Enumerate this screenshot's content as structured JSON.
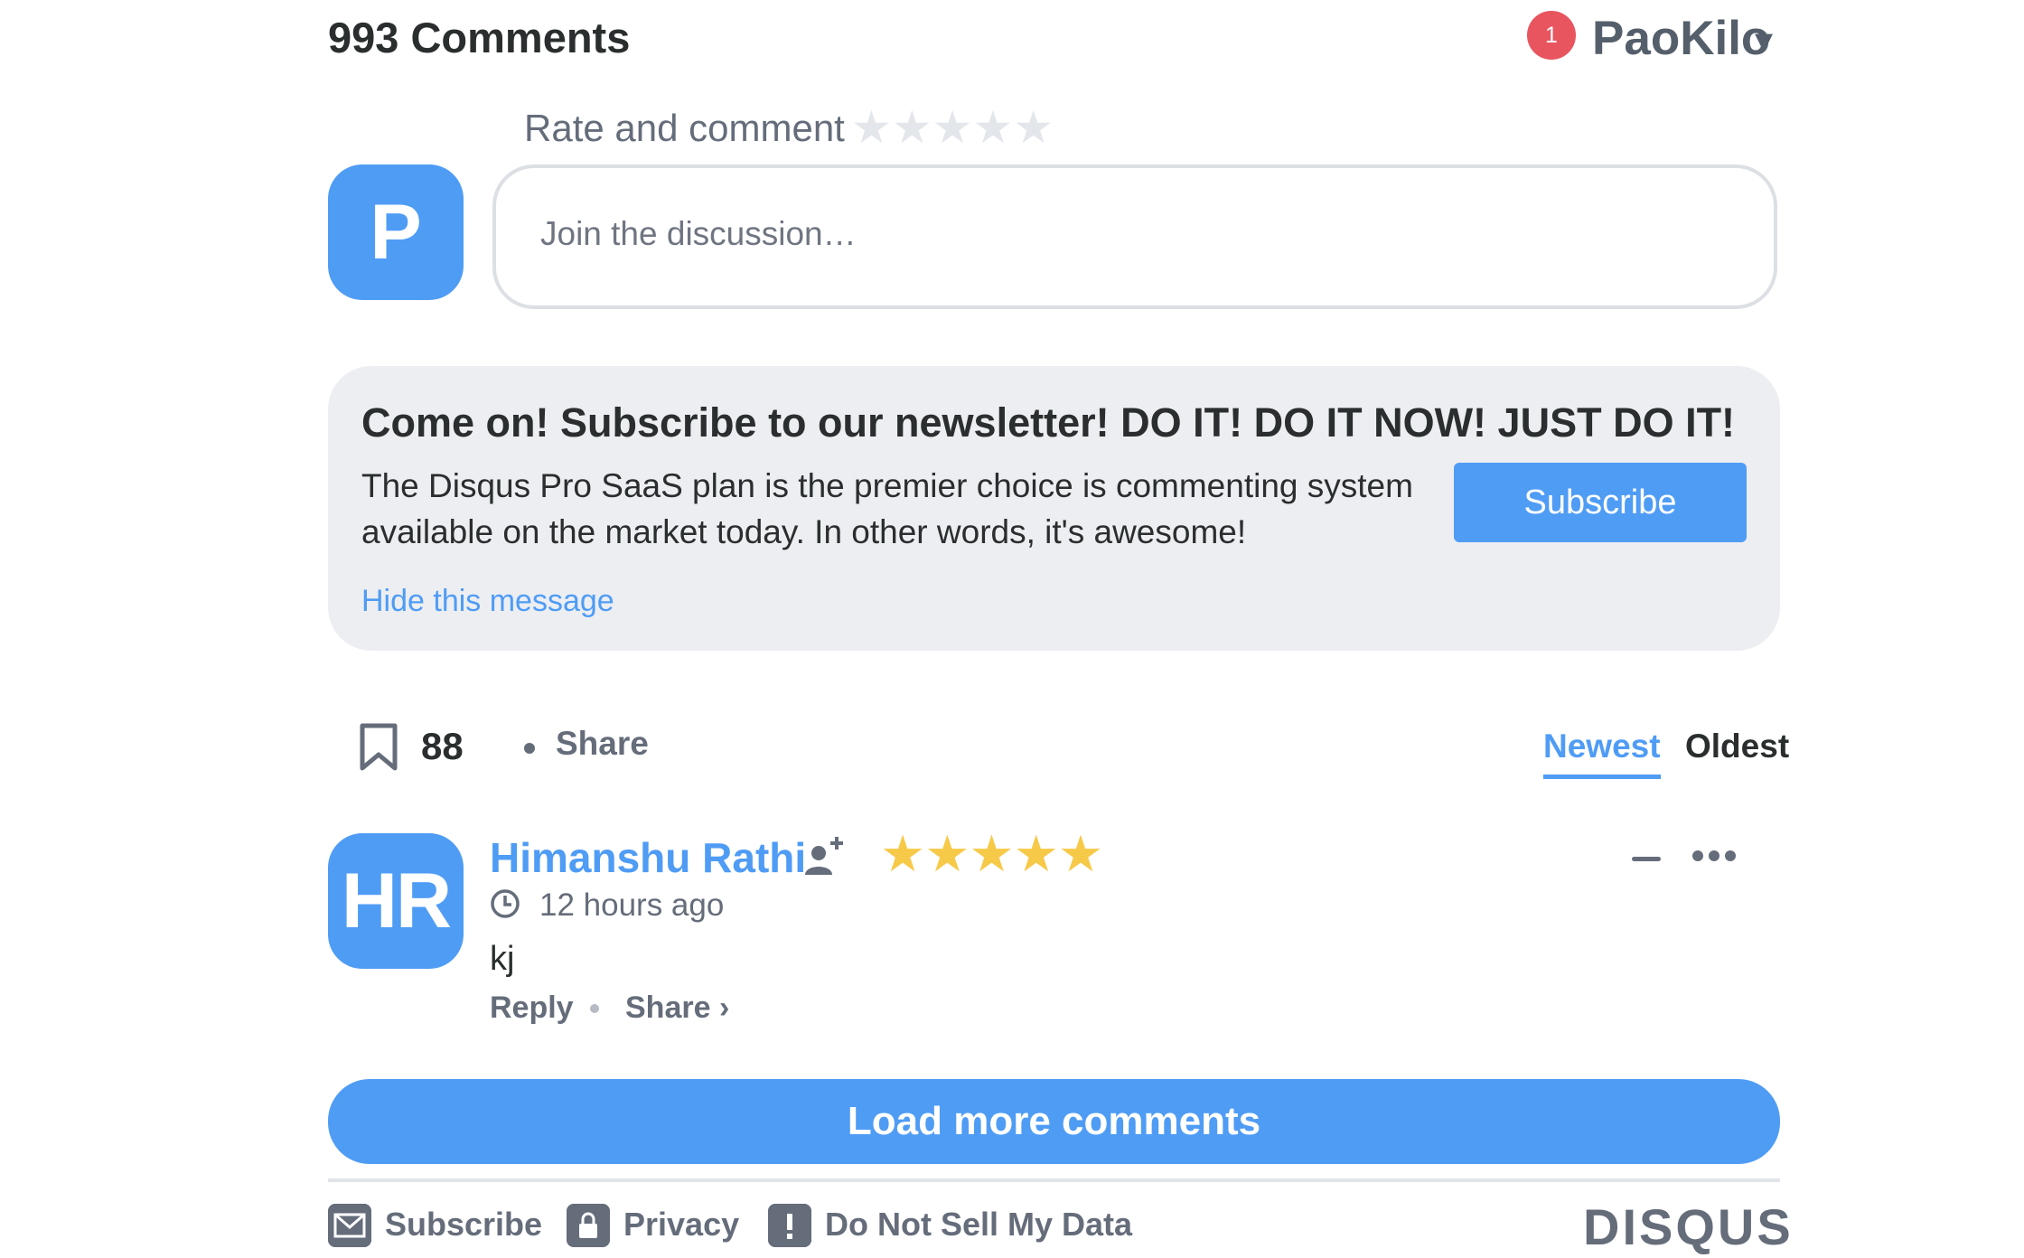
{
  "header": {
    "comment_count": "993 Comments",
    "notification_count": "1",
    "username": "PaoKilo",
    "caret": "▾"
  },
  "rate": {
    "label": "Rate and comment",
    "stars": "★★★★★"
  },
  "composer": {
    "avatar_letter": "P",
    "placeholder": "Join the discussion…"
  },
  "promo": {
    "title": "Come on! Subscribe to our newsletter! DO IT! DO IT NOW! JUST DO IT!",
    "text": "The Disqus Pro SaaS plan is the premier choice is commenting system available on the market today. In other words, it's awesome!",
    "button": "Subscribe",
    "hide": "Hide this message"
  },
  "toolbar": {
    "bookmark_count": "88",
    "share": "Share",
    "tab_newest": "Newest",
    "tab_oldest": "Oldest"
  },
  "comment": {
    "avatar_initials": "HR",
    "author": "Himanshu Rathi",
    "stars": "★★★★★",
    "rating": 5,
    "time": "12 hours ago",
    "body": "kj",
    "reply": "Reply",
    "share": "Share ›"
  },
  "load_more": "Load more comments",
  "footer": {
    "subscribe": "Subscribe",
    "privacy": "Privacy",
    "do_not_sell": "Do Not Sell My Data",
    "logo": "DISQUS"
  },
  "colors": {
    "accent": "#4f9cf5",
    "badge": "#e8555f",
    "star": "#f7c948",
    "muted": "#656c7a",
    "promo_bg": "#eceef1"
  }
}
